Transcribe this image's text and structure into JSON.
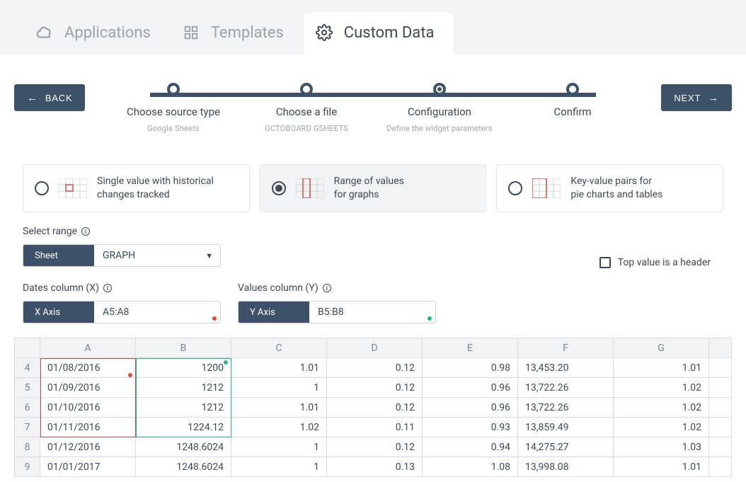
{
  "tabs": {
    "applications": "Applications",
    "templates": "Templates",
    "custom": "Custom Data"
  },
  "nav": {
    "back": "BACK",
    "next": "NEXT"
  },
  "stepper": {
    "s1": {
      "label": "Choose source type",
      "sub": "Google Sheets"
    },
    "s2": {
      "label": "Choose a file",
      "sub": "OCTOBOARD GSHEETS"
    },
    "s3": {
      "label": "Configuration",
      "sub": "Define the widget parameters"
    },
    "s4": {
      "label": "Confirm",
      "sub": ""
    }
  },
  "options": {
    "o1": {
      "line1": "Single value with historical",
      "line2": "changes tracked"
    },
    "o2": {
      "line1": "Range of values",
      "line2": "for graphs"
    },
    "o3": {
      "line1": "Key-value pairs for",
      "line2": "pie charts and tables"
    }
  },
  "range": {
    "select_label": "Select range",
    "sheet_label": "Sheet",
    "sheet_value": "GRAPH",
    "header_checkbox": "Top value is a header",
    "x_title": "Dates column (X)",
    "x_label": "X Axis",
    "x_value": "A5:A8",
    "y_title": "Values column (Y)",
    "y_label": "Y Axis",
    "y_value": "B5:B8"
  },
  "sheet": {
    "cols": [
      "A",
      "B",
      "C",
      "D",
      "E",
      "F",
      "G"
    ],
    "rows": [
      {
        "n": "4",
        "a": "01/08/2016",
        "b": "1200",
        "c": "1.01",
        "d": "0.12",
        "e": "0.98",
        "f": "13,453.20",
        "g": "1.01"
      },
      {
        "n": "5",
        "a": "01/09/2016",
        "b": "1212",
        "c": "1",
        "d": "0.12",
        "e": "0.96",
        "f": "13,722.26",
        "g": "1.02"
      },
      {
        "n": "6",
        "a": "01/10/2016",
        "b": "1212",
        "c": "1.01",
        "d": "0.12",
        "e": "0.96",
        "f": "13,722.26",
        "g": "1.02"
      },
      {
        "n": "7",
        "a": "01/11/2016",
        "b": "1224.12",
        "c": "1.02",
        "d": "0.11",
        "e": "0.93",
        "f": "13,859.49",
        "g": "1.02"
      },
      {
        "n": "8",
        "a": "01/12/2016",
        "b": "1248.6024",
        "c": "1",
        "d": "0.12",
        "e": "0.94",
        "f": "14,275.27",
        "g": "1.03"
      },
      {
        "n": "9",
        "a": "01/01/2017",
        "b": "1248.6024",
        "c": "1",
        "d": "0.13",
        "e": "1.08",
        "f": "13,998.08",
        "g": "1.01"
      }
    ]
  }
}
